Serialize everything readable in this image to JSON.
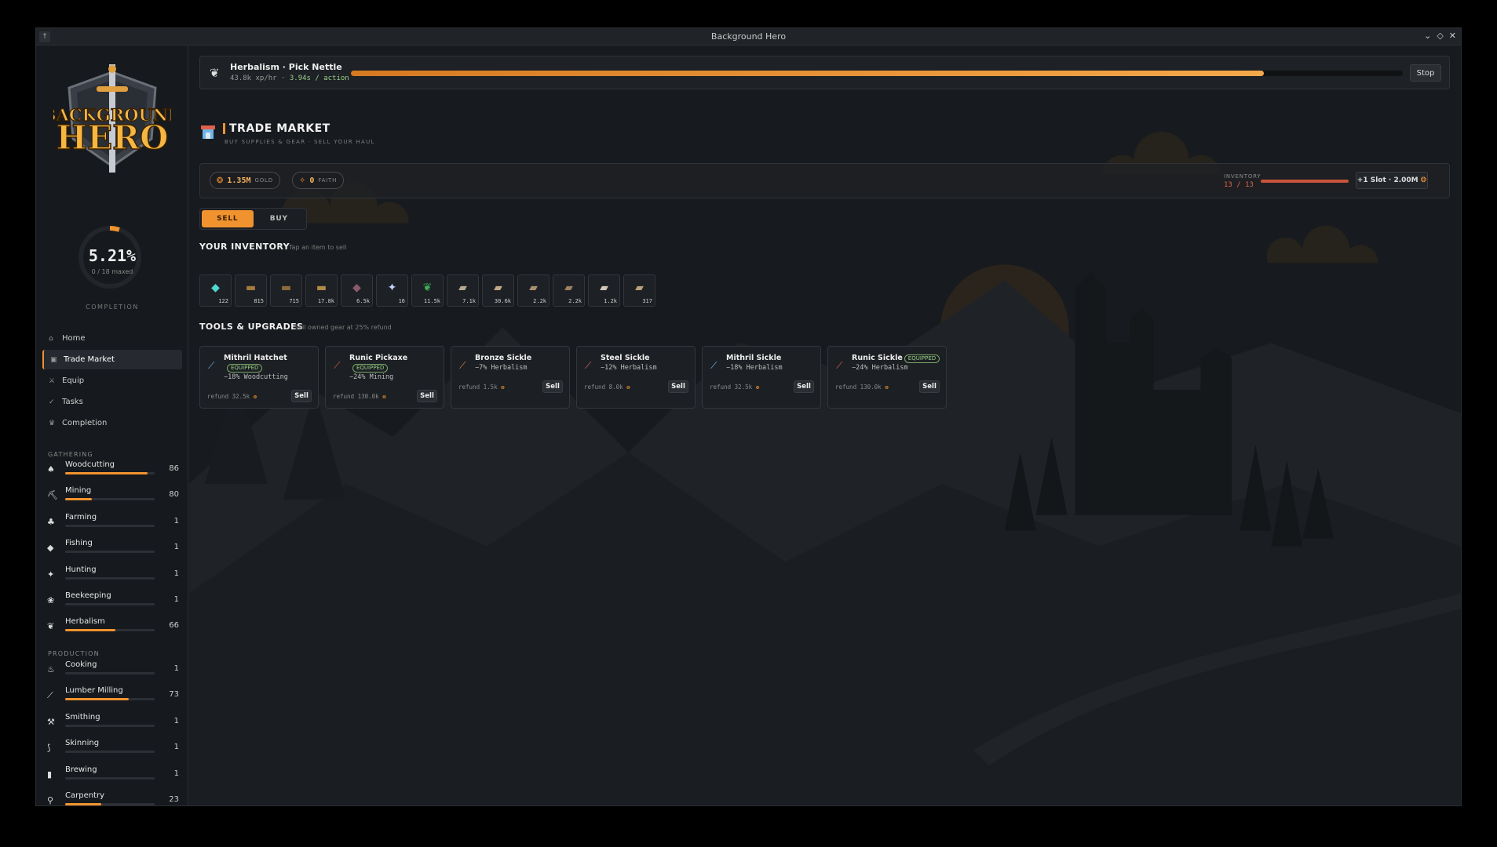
{
  "window": {
    "title": "Background Hero"
  },
  "sidebar": {
    "completion": {
      "percent": "5.21%",
      "sub": "0 / 18 maxed",
      "label": "COMPLETION",
      "fraction": 0.0521
    },
    "nav": [
      {
        "label": "Home",
        "icon": "home-icon",
        "active": false
      },
      {
        "label": "Trade Market",
        "icon": "market-icon",
        "active": true
      },
      {
        "label": "Equip",
        "icon": "equip-icon",
        "active": false
      },
      {
        "label": "Tasks",
        "icon": "tasks-icon",
        "active": false
      },
      {
        "label": "Completion",
        "icon": "trophy-icon",
        "active": false
      }
    ],
    "gathering_label": "GATHERING",
    "production_label": "PRODUCTION",
    "gathering": [
      {
        "name": "Woodcutting",
        "level": "86",
        "progress": 0.92,
        "icon": "woodcutting-icon",
        "glyph": "♠"
      },
      {
        "name": "Mining",
        "level": "80",
        "progress": 0.3,
        "icon": "mining-icon",
        "glyph": "⛏"
      },
      {
        "name": "Farming",
        "level": "1",
        "progress": 0.0,
        "icon": "farming-icon",
        "glyph": "♣"
      },
      {
        "name": "Fishing",
        "level": "1",
        "progress": 0.0,
        "icon": "fishing-icon",
        "glyph": "◆"
      },
      {
        "name": "Hunting",
        "level": "1",
        "progress": 0.0,
        "icon": "hunting-icon",
        "glyph": "✦"
      },
      {
        "name": "Beekeeping",
        "level": "1",
        "progress": 0.0,
        "icon": "beekeeping-icon",
        "glyph": "❀"
      },
      {
        "name": "Herbalism",
        "level": "66",
        "progress": 0.56,
        "icon": "herbalism-icon",
        "glyph": "❦"
      }
    ],
    "production": [
      {
        "name": "Cooking",
        "level": "1",
        "progress": 0.0,
        "icon": "cooking-icon",
        "glyph": "♨"
      },
      {
        "name": "Lumber Milling",
        "level": "73",
        "progress": 0.71,
        "icon": "lumber-milling-icon",
        "glyph": "⟋"
      },
      {
        "name": "Smithing",
        "level": "1",
        "progress": 0.0,
        "icon": "smithing-icon",
        "glyph": "⚒"
      },
      {
        "name": "Skinning",
        "level": "1",
        "progress": 0.0,
        "icon": "skinning-icon",
        "glyph": "⟆"
      },
      {
        "name": "Brewing",
        "level": "1",
        "progress": 0.0,
        "icon": "brewing-icon",
        "glyph": "▮"
      },
      {
        "name": "Carpentry",
        "level": "23",
        "progress": 0.4,
        "icon": "carpentry-icon",
        "glyph": "⚲"
      }
    ]
  },
  "action": {
    "title": "Herbalism · Pick Nettle",
    "xp": "43.8k xp/hr · ",
    "rate": "3.94s / action",
    "progress": 0.868,
    "stop_label": "Stop"
  },
  "market": {
    "title": "TRADE MARKET",
    "subtitle": "BUY SUPPLIES & GEAR · SELL YOUR HAUL",
    "gold": {
      "value": "1.35M",
      "unit": "GOLD"
    },
    "faith": {
      "value": "0",
      "unit": "FAITH"
    },
    "inventory_label": "INVENTORY",
    "inventory_count": "13 / 13",
    "slot_button": "+1 Slot · 2.00M",
    "tabs": {
      "sell": "SELL",
      "buy": "BUY"
    },
    "inventory_title": "YOUR INVENTORY",
    "inventory_hint": "Tap an item to sell",
    "items": [
      {
        "qty": "122",
        "icon": "gem-icon",
        "glyph": "◆",
        "color": "#4fd6d0"
      },
      {
        "qty": "815",
        "icon": "log-icon",
        "glyph": "▬",
        "color": "#a57a3e"
      },
      {
        "qty": "715",
        "icon": "log-icon",
        "glyph": "▬",
        "color": "#8d6a3a"
      },
      {
        "qty": "17.8k",
        "icon": "log-icon",
        "glyph": "▬",
        "color": "#b08a4a"
      },
      {
        "qty": "6.5k",
        "icon": "ore-icon",
        "glyph": "◆",
        "color": "#8a5a6a"
      },
      {
        "qty": "16",
        "icon": "crystal-icon",
        "glyph": "✦",
        "color": "#c0d4ff"
      },
      {
        "qty": "11.5k",
        "icon": "herb-icon",
        "glyph": "❦",
        "color": "#3fae5a"
      },
      {
        "qty": "7.1k",
        "icon": "plank-icon",
        "glyph": "▰",
        "color": "#b7aa92"
      },
      {
        "qty": "30.6k",
        "icon": "plank-icon",
        "glyph": "▰",
        "color": "#c4a886"
      },
      {
        "qty": "2.2k",
        "icon": "plank-icon",
        "glyph": "▰",
        "color": "#a8906e"
      },
      {
        "qty": "2.2k",
        "icon": "plank-icon",
        "glyph": "▰",
        "color": "#9c8262"
      },
      {
        "qty": "1.2k",
        "icon": "plank-icon",
        "glyph": "▰",
        "color": "#d0c8b8"
      },
      {
        "qty": "317",
        "icon": "plank-icon",
        "glyph": "▰",
        "color": "#b8a07c"
      }
    ],
    "tools_title": "TOOLS & UPGRADES",
    "tools_hint": "Sell owned gear at 25% refund",
    "tools": [
      {
        "name": "Mithril Hatchet",
        "equipped": "EQUIPPED",
        "badge_inline": false,
        "bonus": "−18% Woodcutting",
        "refund": "refund 32.5k",
        "sell": "Sell",
        "icon": "hatchet-icon",
        "color": "#6fb4e8"
      },
      {
        "name": "Runic Pickaxe",
        "equipped": "EQUIPPED",
        "badge_inline": false,
        "bonus": "−24% Mining",
        "refund": "refund 130.0k",
        "sell": "Sell",
        "icon": "pickaxe-icon",
        "color": "#e0604a"
      },
      {
        "name": "Bronze Sickle",
        "equipped": "",
        "badge_inline": false,
        "bonus": "−7% Herbalism",
        "refund": "refund 1.5k",
        "sell": "Sell",
        "icon": "sickle-icon",
        "color": "#e08a4a"
      },
      {
        "name": "Steel Sickle",
        "equipped": "",
        "badge_inline": false,
        "bonus": "−12% Herbalism",
        "refund": "refund 8.0k",
        "sell": "Sell",
        "icon": "sickle-icon",
        "color": "#e07060"
      },
      {
        "name": "Mithril Sickle",
        "equipped": "",
        "badge_inline": false,
        "bonus": "−18% Herbalism",
        "refund": "refund 32.5k",
        "sell": "Sell",
        "icon": "sickle-icon",
        "color": "#6fb4e8"
      },
      {
        "name": "Runic Sickle",
        "equipped": "EQUIPPED",
        "badge_inline": true,
        "bonus": "−24% Herbalism",
        "refund": "refund 130.0k",
        "sell": "Sell",
        "icon": "sickle-icon",
        "color": "#e0604a"
      }
    ]
  },
  "colors": {
    "accent": "#f0932f",
    "danger": "#e06548",
    "equipped": "#9bd08a"
  }
}
